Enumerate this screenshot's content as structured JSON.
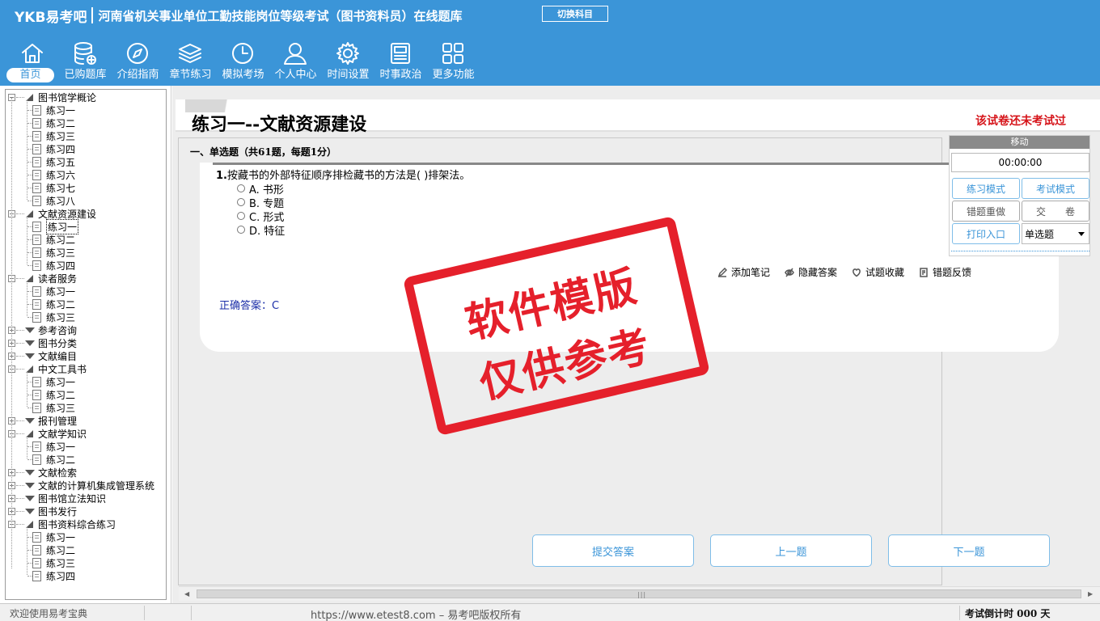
{
  "header": {
    "logo": "YKB易考吧",
    "title": "河南省机关事业单位工勤技能岗位等级考试（图书资料员）在线题库",
    "switch_subject": "切换科目",
    "bg_color": "#3b95d8"
  },
  "nav": [
    {
      "label": "首页",
      "icon": "home-icon"
    },
    {
      "label": "已购题库",
      "icon": "database-icon"
    },
    {
      "label": "介绍指南",
      "icon": "compass-icon"
    },
    {
      "label": "章节练习",
      "icon": "layers-icon"
    },
    {
      "label": "模拟考场",
      "icon": "clock-icon"
    },
    {
      "label": "个人中心",
      "icon": "user-icon"
    },
    {
      "label": "时间设置",
      "icon": "gear-icon"
    },
    {
      "label": "时事政治",
      "icon": "news-icon"
    },
    {
      "label": "更多功能",
      "icon": "grid-icon"
    }
  ],
  "tree": [
    {
      "label": "图书馆学概论",
      "expanded": true,
      "children": [
        "练习一",
        "练习二",
        "练习三",
        "练习四",
        "练习五",
        "练习六",
        "练习七",
        "练习八"
      ]
    },
    {
      "label": "文献资源建设",
      "expanded": true,
      "children": [
        "练习一",
        "练习二",
        "练习三",
        "练习四"
      ]
    },
    {
      "label": "读者服务",
      "expanded": true,
      "children": [
        "练习一",
        "练习二",
        "练习三"
      ]
    },
    {
      "label": "参考咨询",
      "expanded": false,
      "children": []
    },
    {
      "label": "图书分类",
      "expanded": false,
      "children": []
    },
    {
      "label": "文献编目",
      "expanded": false,
      "children": []
    },
    {
      "label": "中文工具书",
      "expanded": true,
      "children": [
        "练习一",
        "练习二",
        "练习三"
      ]
    },
    {
      "label": "报刊管理",
      "expanded": false,
      "children": []
    },
    {
      "label": "文献学知识",
      "expanded": true,
      "children": [
        "练习一",
        "练习二"
      ]
    },
    {
      "label": "文献检索",
      "expanded": false,
      "children": []
    },
    {
      "label": "文献的计算机集成管理系统",
      "expanded": false,
      "children": []
    },
    {
      "label": "图书馆立法知识",
      "expanded": false,
      "children": []
    },
    {
      "label": "图书发行",
      "expanded": false,
      "children": []
    },
    {
      "label": "图书资料综合练习",
      "expanded": true,
      "children": [
        "练习一",
        "练习二",
        "练习三",
        "练习四"
      ]
    }
  ],
  "main": {
    "page_title": "练习一--文献资源建设",
    "status_note": "该试卷还未考试过",
    "section": "一、单选题（共61题，每题1分）",
    "question_no": "1.",
    "question_text": "按藏书的外部特征顺序排检藏书的方法是( )排架法。",
    "options": [
      "A. 书形",
      "B. 专题",
      "C. 形式",
      "D. 特征"
    ],
    "tools": [
      {
        "label": "添加笔记",
        "icon": "pencil-icon"
      },
      {
        "label": "隐藏答案",
        "icon": "eye-icon"
      },
      {
        "label": "试题收藏",
        "icon": "heart-icon"
      },
      {
        "label": "错题反馈",
        "icon": "feedback-icon"
      }
    ],
    "answer": "正确答案：C",
    "watermark": [
      "软件模版",
      "仅供参考"
    ],
    "buttons": {
      "submit": "提交答案",
      "prev": "上一题",
      "next": "下一题"
    }
  },
  "panel": {
    "title": "移动",
    "timer": "00:00:00",
    "practice_mode": "练习模式",
    "exam_mode": "考试模式",
    "redo_wrong": "错题重做",
    "hand_in": "交　　卷",
    "print": "打印入口",
    "question_type": "单选题"
  },
  "status": {
    "welcome": "欢迎使用易考宝典",
    "copyright": "https://www.etest8.com – 易考吧版权所有",
    "countdown": "考试倒计时 000 天"
  }
}
